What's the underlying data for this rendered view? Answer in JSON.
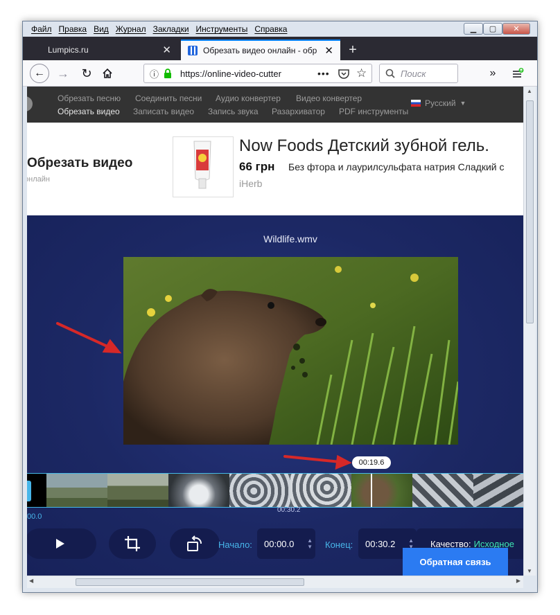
{
  "menubar": {
    "items": [
      "Файл",
      "Правка",
      "Вид",
      "Журнал",
      "Закладки",
      "Инструменты",
      "Справка"
    ]
  },
  "tabs": [
    {
      "label": "Lumpics.ru",
      "active": false
    },
    {
      "label": "Обрезать видео онлайн - обр",
      "active": true
    }
  ],
  "navbar": {
    "url": "https://online-video-cutter",
    "search_placeholder": "Поиск"
  },
  "site_nav": {
    "row1": [
      "Обрезать песню",
      "Соединить песни",
      "Аудио конвертер",
      "Видео конвертер"
    ],
    "row2": [
      "Обрезать видео",
      "Записать видео",
      "Запись звука",
      "Разархиватор",
      "PDF инструменты"
    ],
    "language": "Русский"
  },
  "page": {
    "title": "Обрезать видео",
    "subtitle": "онлайн"
  },
  "ad": {
    "title": "Now Foods Детский зубной гель.",
    "price": "66 грн",
    "description": "Без фтора и лаурилсульфата натрия Сладкий с",
    "vendor": "iHerb"
  },
  "editor": {
    "file_name": "Wildlife.wmv",
    "playhead_time": "00:19.6",
    "timeline_start": "00.0",
    "timeline_end": "00:30.2",
    "start_label": "Начало:",
    "start_value": "00:00.0",
    "end_label": "Конец:",
    "end_value": "00:30.2",
    "quality_label": "Качество:",
    "quality_value": "Исходное",
    "feedback_label": "Обратная связь"
  },
  "colors": {
    "accent_blue": "#48b6ea",
    "quality_green": "#3ee8b3",
    "feedback_blue": "#2b7bf2",
    "editor_bg": "#1c2864",
    "annotation_arrow": "#d62828"
  }
}
